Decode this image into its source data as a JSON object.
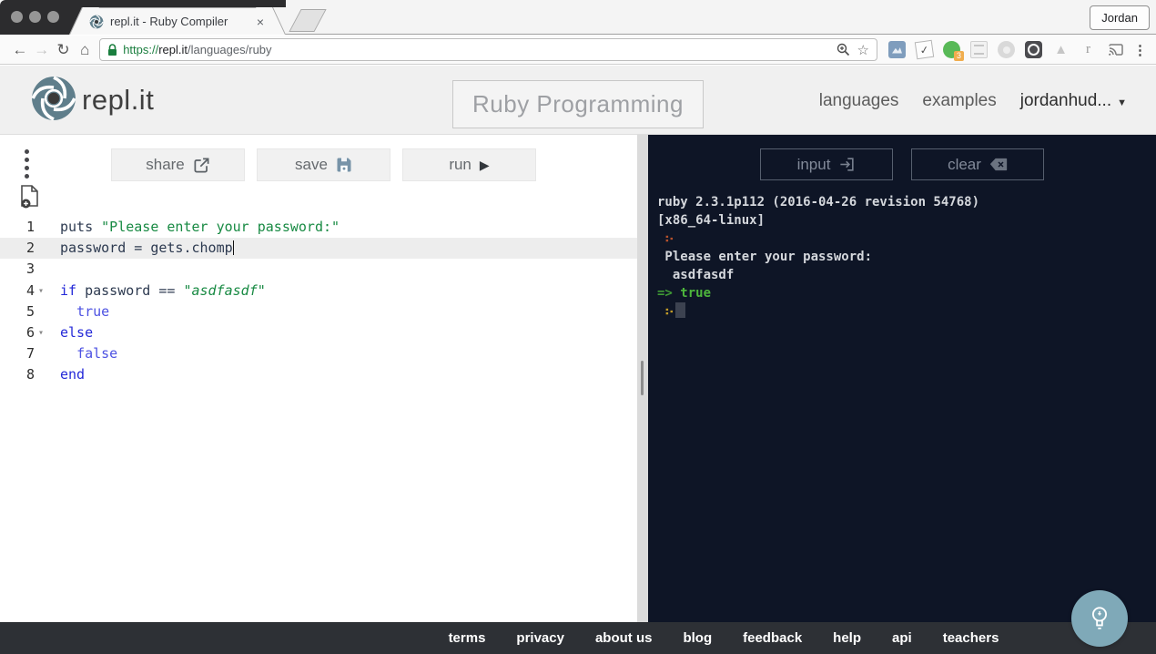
{
  "browser": {
    "tab": {
      "title": "repl.it - Ruby Compiler",
      "close_glyph": "×"
    },
    "profile_button": "Jordan",
    "url": {
      "scheme": "https://",
      "domain": "repl.it",
      "path": "/languages/ruby"
    },
    "extensions": {
      "badge_count": "3",
      "r_label": "r"
    }
  },
  "header": {
    "logo_text": "repl.it",
    "page_title": "Ruby Programming",
    "nav": [
      {
        "label": "languages"
      },
      {
        "label": "examples"
      },
      {
        "label": "jordanhud..."
      }
    ]
  },
  "editor": {
    "buttons": {
      "share": "share",
      "save": "save",
      "run": "run"
    },
    "fold_char": "▾",
    "lines": [
      {
        "num": "1",
        "fold": false,
        "active": false,
        "segs": [
          [
            "puts ",
            "plain"
          ],
          [
            "\"Please enter your password:\"",
            "str"
          ]
        ]
      },
      {
        "num": "2",
        "fold": false,
        "active": true,
        "cursor": true,
        "segs": [
          [
            "password = gets.chomp",
            "plain"
          ]
        ]
      },
      {
        "num": "3",
        "fold": false,
        "active": false,
        "segs": []
      },
      {
        "num": "4",
        "fold": true,
        "active": false,
        "segs": [
          [
            "if",
            "kw"
          ],
          [
            " password == ",
            "plain"
          ],
          [
            "\"asdfasdf\"",
            "stri"
          ]
        ]
      },
      {
        "num": "5",
        "fold": false,
        "active": false,
        "segs": [
          [
            "  ",
            "plain"
          ],
          [
            "true",
            "atom"
          ]
        ]
      },
      {
        "num": "6",
        "fold": true,
        "active": false,
        "segs": [
          [
            "else",
            "kw"
          ]
        ]
      },
      {
        "num": "7",
        "fold": false,
        "active": false,
        "segs": [
          [
            "  ",
            "plain"
          ],
          [
            "false",
            "atom"
          ]
        ]
      },
      {
        "num": "8",
        "fold": false,
        "active": false,
        "segs": [
          [
            "end",
            "kw"
          ]
        ]
      }
    ]
  },
  "console": {
    "buttons": {
      "input": "input",
      "clear": "clear"
    },
    "prompt_char": "∴",
    "lines": [
      {
        "segs": [
          [
            "ruby 2.3.1p112 (2016-04-26 revision 54768)",
            "out"
          ]
        ]
      },
      {
        "segs": [
          [
            "[x86_64-linux]",
            "out"
          ]
        ]
      },
      {
        "prompt": "orange"
      },
      {
        "segs": [
          [
            " Please enter your password:",
            "out"
          ]
        ]
      },
      {
        "segs": [
          [
            "  asdfasdf",
            "out"
          ]
        ]
      },
      {
        "segs": [
          [
            "=> ",
            "arrow"
          ],
          [
            "true",
            "result"
          ]
        ]
      },
      {
        "prompt": "gold",
        "cursor": true
      }
    ]
  },
  "footer": {
    "links": [
      "terms",
      "privacy",
      "about us",
      "blog",
      "feedback",
      "help",
      "api",
      "teachers"
    ]
  },
  "colors": {
    "console-bg": "#0e1526",
    "footer-bg": "#2d3035",
    "header-bg": "#f0f0f0",
    "bulb-bg": "#7fa9b8",
    "keyword": "#2429d8",
    "atom": "#4d52e2",
    "string": "#188a43",
    "code-default": "#2d3a50",
    "prompt-orange": "#b5512c",
    "prompt-gold": "#c09a28",
    "result-green": "#4db53c",
    "arrow-green": "#3f9b35",
    "console-text": "#d4d7dc",
    "url-green": "#1a7e3e",
    "save-icon": "#7793a8"
  }
}
